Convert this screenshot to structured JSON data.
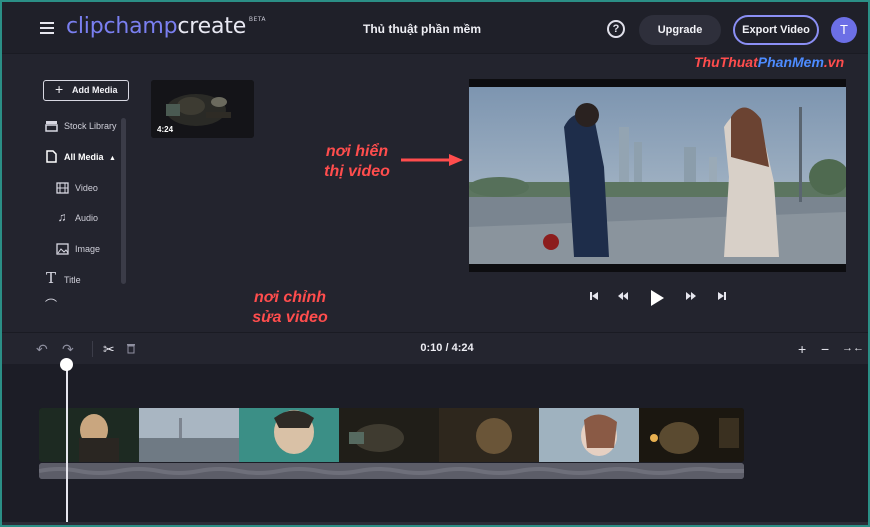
{
  "header": {
    "logo_brand": "clipchamp",
    "logo_product": "create",
    "logo_badge": "BETA",
    "project_title": "Thủ thuật phần mềm",
    "help_label": "?",
    "upgrade_label": "Upgrade",
    "export_label": "Export Video",
    "avatar_initial": "T"
  },
  "sidebar": {
    "add_media_label": "Add Media",
    "items": [
      {
        "label": "Stock Library",
        "icon": "stock-library-icon"
      },
      {
        "label": "All Media",
        "icon": "file-icon",
        "expanded": true
      },
      {
        "label": "Video",
        "icon": "film-icon"
      },
      {
        "label": "Audio",
        "icon": "music-note-icon"
      },
      {
        "label": "Image",
        "icon": "image-icon"
      },
      {
        "label": "Title",
        "icon": "text-icon"
      }
    ]
  },
  "media": {
    "thumbnail_duration": "4:24"
  },
  "watermark": {
    "part1": "Thu",
    "part2": "Thuat",
    "part3": "PhanMem",
    "part4": ".vn"
  },
  "annotations": {
    "preview_line1": "nơi hiển",
    "preview_line2": "thị video",
    "edit_line1": "nơi chỉnh",
    "edit_line2": "sửa video"
  },
  "timeline": {
    "current_time": "0:10",
    "total_time": "4:24",
    "time_display": "0:10 / 4:24",
    "playhead_position": 0.038
  },
  "colors": {
    "accent": "#7a7ff0",
    "annotation": "#ff4d4d",
    "frame_border": "#2b8f86"
  }
}
